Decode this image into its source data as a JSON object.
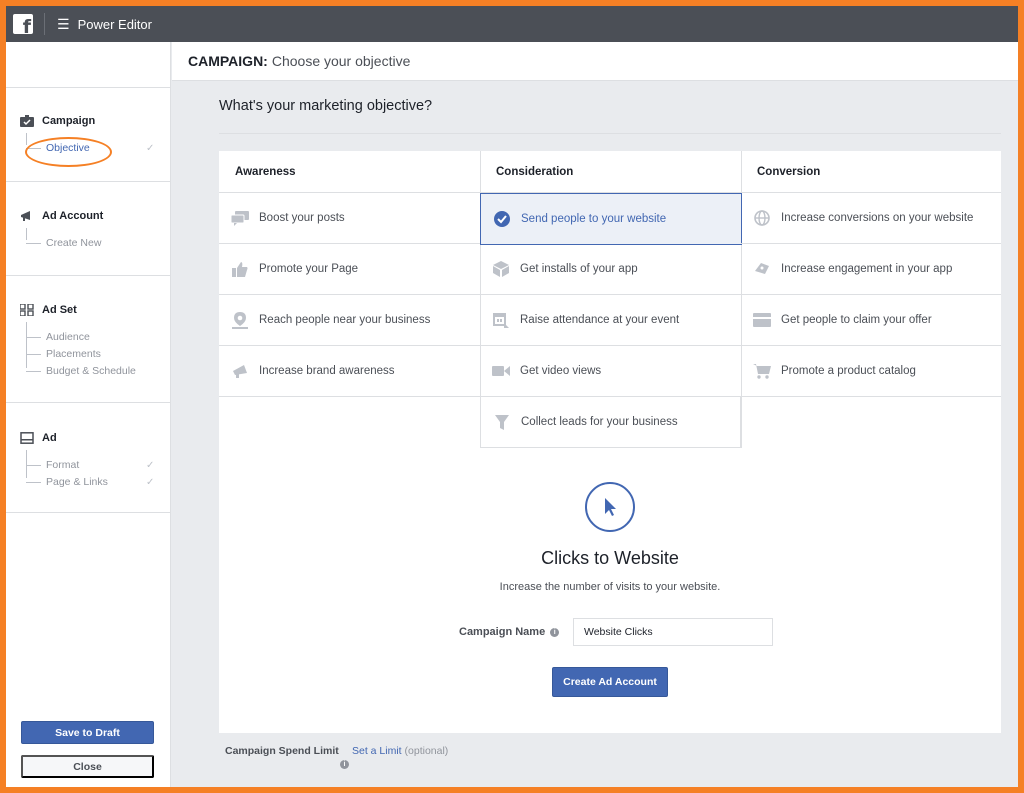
{
  "topbar": {
    "app_title": "Power Editor",
    "logo_letter": "f"
  },
  "header": {
    "prefix": "CAMPAIGN:",
    "title": "Choose your objective"
  },
  "sidebar": {
    "campaign": {
      "title": "Campaign",
      "items": [
        "Objective"
      ]
    },
    "ad_account": {
      "title": "Ad Account",
      "items": [
        "Create New"
      ]
    },
    "ad_set": {
      "title": "Ad Set",
      "items": [
        "Audience",
        "Placements",
        "Budget & Schedule"
      ]
    },
    "ad": {
      "title": "Ad",
      "items": [
        "Format",
        "Page & Links"
      ]
    },
    "save_label": "Save to Draft",
    "close_label": "Close"
  },
  "main": {
    "question": "What's your marketing objective?",
    "columns": [
      {
        "title": "Awareness",
        "items": [
          "Boost your posts",
          "Promote your Page",
          "Reach people near your business",
          "Increase brand awareness"
        ]
      },
      {
        "title": "Consideration",
        "items": [
          "Send people to your website",
          "Get installs of your app",
          "Raise attendance at your event",
          "Get video views",
          "Collect leads for your business"
        ]
      },
      {
        "title": "Conversion",
        "items": [
          "Increase conversions on your website",
          "Increase engagement in your app",
          "Get people to claim your offer",
          "Promote a product catalog"
        ]
      }
    ],
    "selected_objective": "Send people to your website",
    "objective_title": "Clicks to Website",
    "objective_description": "Increase the number of visits to your website.",
    "campaign_name_label": "Campaign Name",
    "campaign_name_value": "Website Clicks",
    "create_button": "Create Ad Account",
    "spend_limit_label": "Campaign Spend Limit",
    "set_limit_link": "Set a Limit",
    "set_limit_hint": "(optional)"
  },
  "colors": {
    "accent": "#4267b2",
    "topbar": "#4b4f56",
    "highlight": "#f58025"
  }
}
